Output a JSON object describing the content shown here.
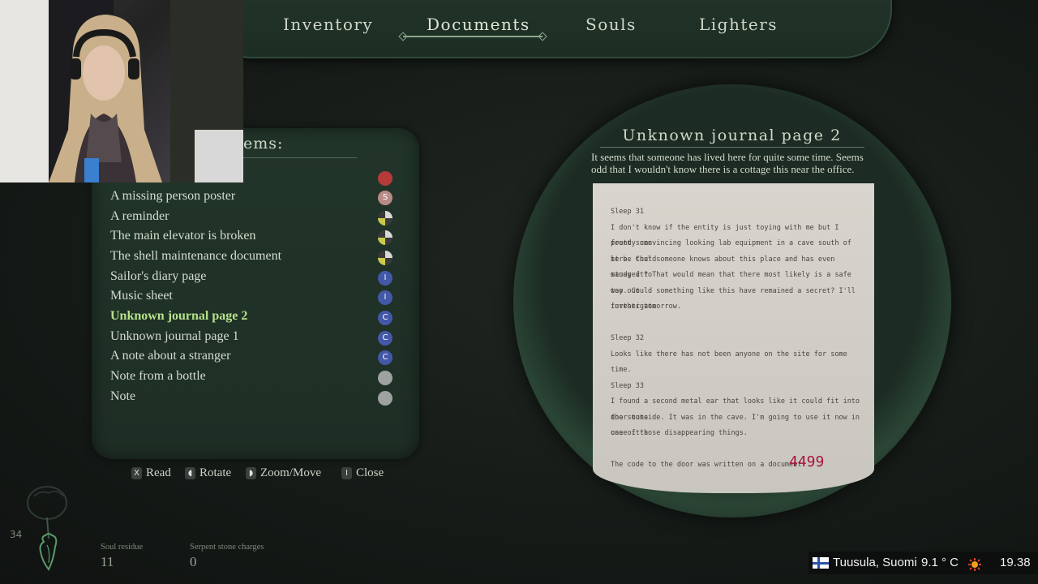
{
  "tabs": [
    {
      "label": "Inventory",
      "active": false
    },
    {
      "label": "Documents",
      "active": true
    },
    {
      "label": "Souls",
      "active": false
    },
    {
      "label": "Lighters",
      "active": false
    }
  ],
  "list": {
    "header": "ems:",
    "items": [
      {
        "label": "A missing person poster",
        "icon": "missing-person-icon"
      },
      {
        "label": "A reminder",
        "icon": "note-icon"
      },
      {
        "label": "The main elevator is broken",
        "icon": "note-icon"
      },
      {
        "label": "The shell maintenance document",
        "icon": "note-icon"
      },
      {
        "label": "Sailor's diary page",
        "icon": "diary-icon"
      },
      {
        "label": "Music sheet",
        "icon": "diary-icon"
      },
      {
        "label": "Unknown journal page 2",
        "icon": "journal-icon",
        "selected": true
      },
      {
        "label": "Unknown journal page 1",
        "icon": "journal-icon"
      },
      {
        "label": "A note about a stranger",
        "icon": "journal-icon"
      },
      {
        "label": "Note from a bottle",
        "icon": "bottle-icon"
      },
      {
        "label": "Note",
        "icon": "bottle-icon"
      }
    ]
  },
  "controls": {
    "read": "Read",
    "rotate": "Rotate",
    "zoom": "Zoom/Move",
    "close": "Close"
  },
  "viewer": {
    "title": "Unknown journal page 2",
    "description": "It seems that someone has lived here for quite some time. Seems odd that I wouldn't know there is a cottage this near the office.",
    "paper_lines": [
      "Sleep 31",
      "I don't know if the entity is just toying with me but I found some",
      "pretty convincing looking lab equipment in a cave south of here. Could",
      "it be that someone knows about this place and has even managed to",
      "study it? That would mean that there most likely is a safe way out",
      "too. Could something like this have remained a secret? I'll investigate",
      "further tomorrow.",
      "",
      "Sleep 32",
      "Looks like there has not been anyone on the site for some time.",
      "",
      "Sleep 33",
      "I found a second metal ear that looks like it could fit into the stone",
      "door outside. It was in the cave. I'm going to use it now in case it's",
      "one of those disappearing things.",
      "",
      "The code to the door was written on a document"
    ],
    "code": "4499"
  },
  "hud": {
    "number": "34",
    "soul_residue_label": "Soul residue",
    "soul_residue_value": "11",
    "serpent_label": "Serpent stone charges",
    "serpent_value": "0"
  },
  "overlay": {
    "location": "Tuusula, Suomi",
    "temperature": "9.1 ° C",
    "time": "19.38"
  }
}
